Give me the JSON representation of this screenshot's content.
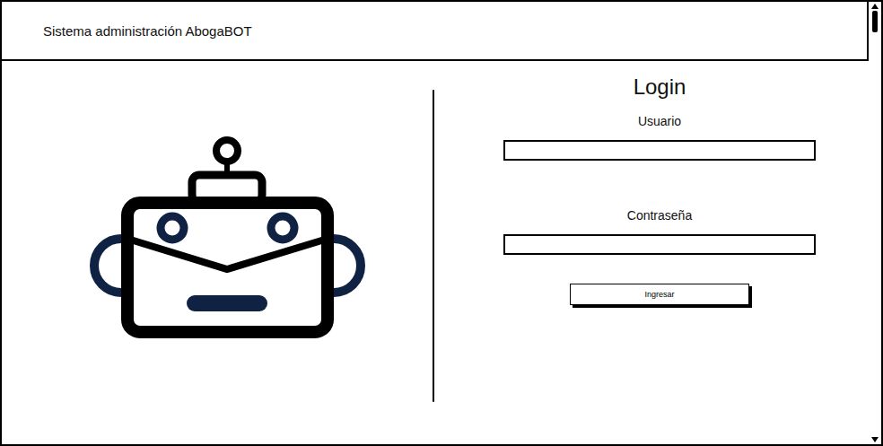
{
  "window": {
    "title": "Sistema administración AbogaBOT"
  },
  "login": {
    "title": "Login",
    "fields": [
      {
        "label": "Usuario"
      },
      {
        "label": "Contraseña"
      }
    ],
    "button": "Ingresar"
  }
}
